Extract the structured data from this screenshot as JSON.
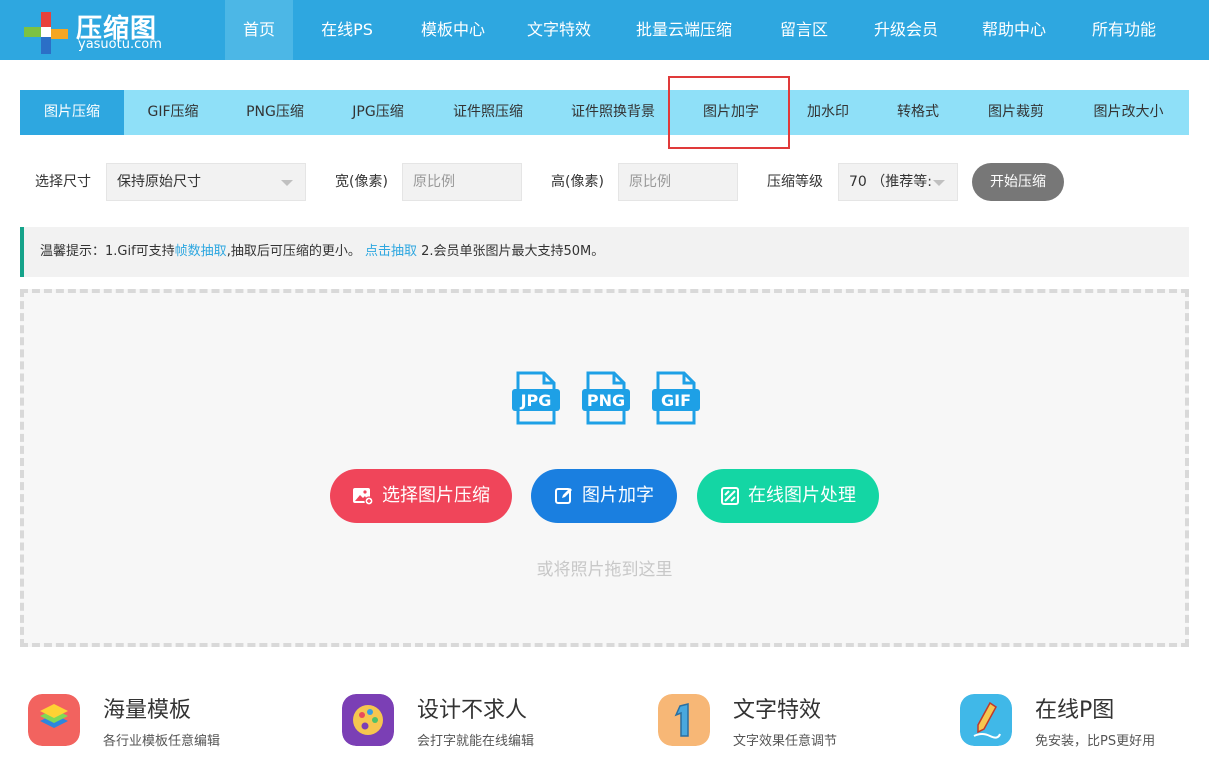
{
  "header": {
    "logo_title": "压缩图",
    "logo_sub": "yasuotu.com",
    "nav": [
      {
        "label": "首页",
        "active": true
      },
      {
        "label": "在线PS"
      },
      {
        "label": "模板中心"
      },
      {
        "label": "文字特效"
      },
      {
        "label": "批量云端压缩"
      },
      {
        "label": "留言区"
      },
      {
        "label": "升级会员"
      },
      {
        "label": "帮助中心"
      },
      {
        "label": "所有功能"
      }
    ]
  },
  "tabs": [
    {
      "label": "图片压缩",
      "active": true
    },
    {
      "label": "GIF压缩"
    },
    {
      "label": "PNG压缩"
    },
    {
      "label": "JPG压缩"
    },
    {
      "label": "证件照压缩"
    },
    {
      "label": "证件照换背景"
    },
    {
      "label": "图片加字",
      "highlighted": true
    },
    {
      "label": "加水印"
    },
    {
      "label": "转格式"
    },
    {
      "label": "图片裁剪"
    },
    {
      "label": "图片改大小"
    }
  ],
  "options": {
    "size_label": "选择尺寸",
    "size_value": "保持原始尺寸",
    "width_label": "宽(像素)",
    "width_placeholder": "原比例",
    "height_label": "高(像素)",
    "height_placeholder": "原比例",
    "level_label": "压缩等级",
    "level_value": "70 （推荐等:",
    "start_button": "开始压缩"
  },
  "notice": {
    "prefix": "温馨提示：1.Gif可支持",
    "link1": "帧数抽取",
    "middle": ",抽取后可压缩的更小。 ",
    "link2": "点击抽取",
    "suffix": " 2.会员单张图片最大支持50M。"
  },
  "dropzone": {
    "file_types": [
      "JPG",
      "PNG",
      "GIF"
    ],
    "btn_compress": "选择图片压缩",
    "btn_text": "图片加字",
    "btn_online": "在线图片处理",
    "hint": "或将照片拖到这里"
  },
  "features": [
    {
      "title": "海量模板",
      "desc": "各行业模板任意编辑",
      "icon": "layers-icon"
    },
    {
      "title": "设计不求人",
      "desc": "会打字就能在线编辑",
      "icon": "palette-icon"
    },
    {
      "title": "文字特效",
      "desc": "文字效果任意调节",
      "icon": "number-one-icon"
    },
    {
      "title": "在线P图",
      "desc": "免安装，比PS更好用",
      "icon": "pencil-icon"
    }
  ],
  "colors": {
    "header_bg": "#2ea7e0",
    "tabs_bg": "#8fe0f8",
    "highlight_box": "#e03a3a",
    "btn_red": "#f0455a",
    "btn_blue": "#1a7fe0",
    "btn_green": "#14d6a4"
  }
}
